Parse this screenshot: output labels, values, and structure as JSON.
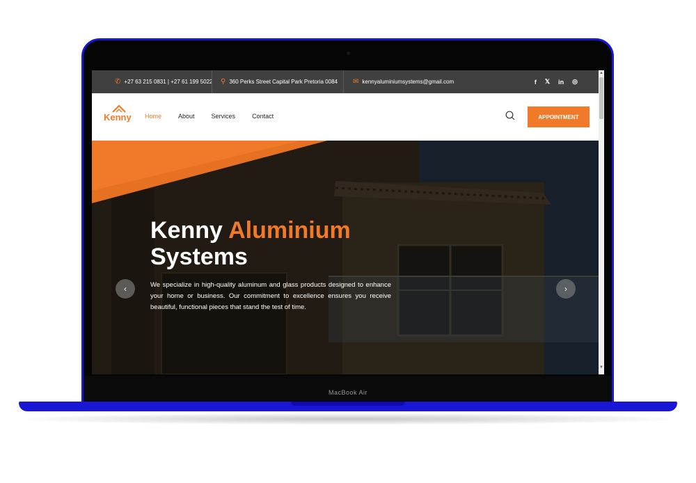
{
  "topbar": {
    "phone": "+27 63 215 0831 | +27 61 199 5022",
    "address": "360 Perks Street Capital Park Pretoria 0084",
    "email": "kennyaluminiumsystems@gmail.com",
    "social": [
      "f",
      "𝕏",
      "in",
      "◎"
    ]
  },
  "nav": {
    "logo_text": "Kenny",
    "links": [
      "Home",
      "About",
      "Services",
      "Contact"
    ],
    "appointment_label": "APPOINTMENT"
  },
  "hero": {
    "title_part1": "Kenny ",
    "title_accent": "Aluminium",
    "title_part2": "Systems",
    "description": "We specialize in high-quality aluminum and glass products designed to enhance your home or business. Our commitment to excellence ensures you receive beautiful, functional pieces that stand the test of time.",
    "prev_label": "‹",
    "next_label": "›"
  },
  "device": {
    "model": "MacBook Air"
  },
  "colors": {
    "accent": "#f07a2a",
    "topbar": "#404040",
    "device_blue": "#1a16d6"
  }
}
